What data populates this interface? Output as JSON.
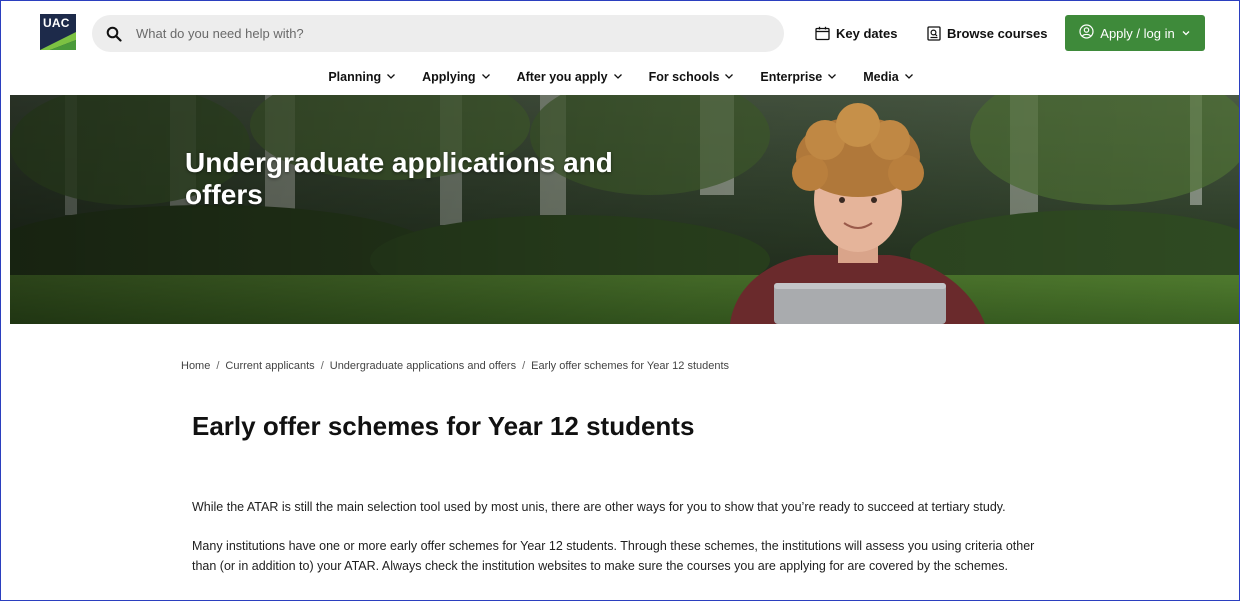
{
  "header": {
    "logo_text": "UAC",
    "search_placeholder": "What do you need help with?",
    "key_dates_label": "Key dates",
    "browse_courses_label": "Browse courses",
    "apply_label": "Apply / log in"
  },
  "nav": {
    "items": [
      {
        "label": "Planning"
      },
      {
        "label": "Applying"
      },
      {
        "label": "After you apply"
      },
      {
        "label": "For schools"
      },
      {
        "label": "Enterprise"
      },
      {
        "label": "Media"
      }
    ]
  },
  "hero": {
    "title": "Undergraduate applications and offers"
  },
  "breadcrumb": {
    "items": [
      "Home",
      "Current applicants",
      "Undergraduate applications and offers",
      "Early offer schemes for Year 12 students"
    ],
    "separator": "/"
  },
  "content": {
    "title": "Early offer schemes for Year 12 students",
    "paragraphs": [
      "While the ATAR is still the main selection tool used by most unis, there are other ways for you to show that you’re ready to succeed at tertiary study.",
      "Many institutions have one or more early offer schemes for Year 12 students. Through these schemes, the institutions will assess you using criteria other than (or in addition to) your ATAR. Always check the institution websites to make sure the courses you are applying for are covered by the schemes."
    ]
  },
  "colors": {
    "brand_navy": "#1d2a4a",
    "brand_green": "#3e8a3a",
    "border": "#2b3fbf"
  }
}
